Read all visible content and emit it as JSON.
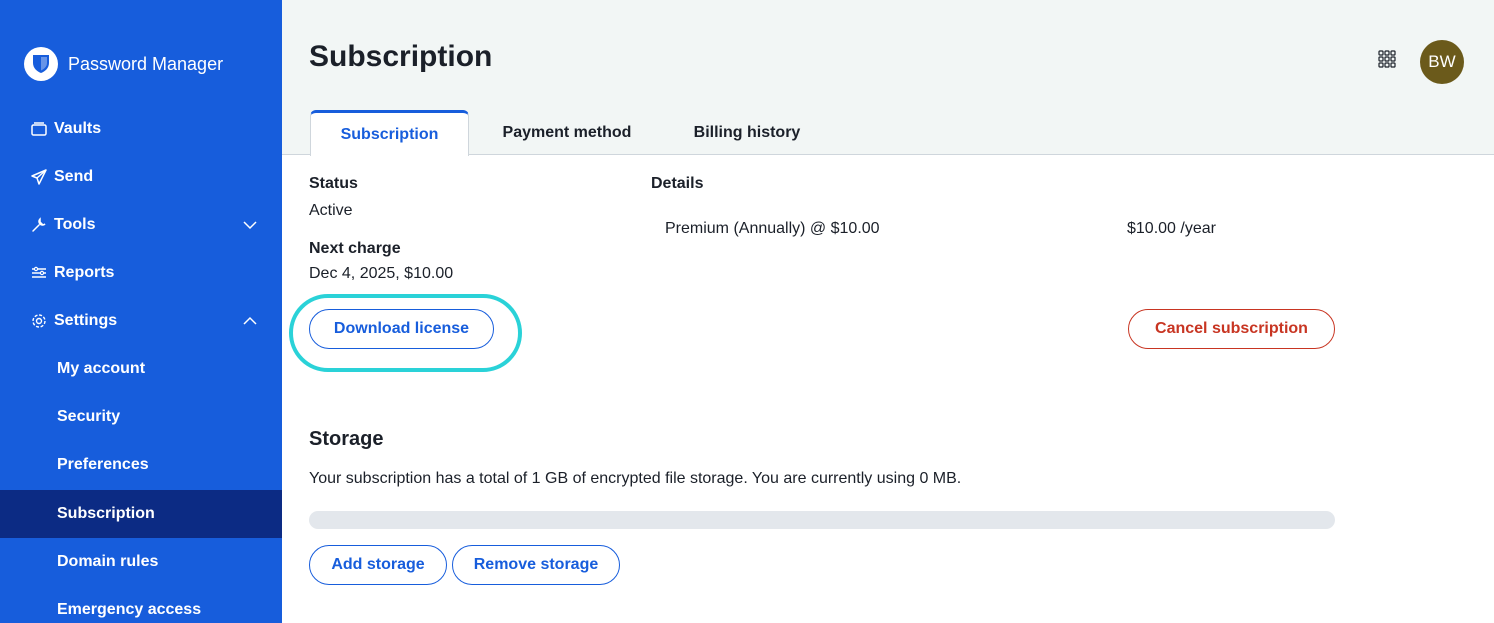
{
  "sidebar": {
    "brand": "Password Manager",
    "nav": [
      {
        "label": "Vaults",
        "icon": "vault-icon"
      },
      {
        "label": "Send",
        "icon": "send-icon"
      },
      {
        "label": "Tools",
        "icon": "tools-icon",
        "chevron": "down"
      },
      {
        "label": "Reports",
        "icon": "reports-icon"
      },
      {
        "label": "Settings",
        "icon": "settings-icon",
        "chevron": "up"
      }
    ],
    "settings_items": [
      {
        "label": "My account"
      },
      {
        "label": "Security"
      },
      {
        "label": "Preferences"
      },
      {
        "label": "Subscription",
        "active": true
      },
      {
        "label": "Domain rules"
      },
      {
        "label": "Emergency access"
      }
    ]
  },
  "header": {
    "title": "Subscription",
    "avatar_initials": "BW",
    "avatar_color": "#6b5a1b",
    "tabs": [
      {
        "label": "Subscription",
        "active": true
      },
      {
        "label": "Payment method"
      },
      {
        "label": "Billing history"
      }
    ]
  },
  "subscription": {
    "status_label": "Status",
    "status_value": "Active",
    "next_charge_label": "Next charge",
    "next_charge_value": "Dec 4, 2025, $10.00",
    "details_label": "Details",
    "plan_line": "Premium (Annually) @ $10.00",
    "plan_price": "$10.00 /year",
    "download_license_button": "Download license",
    "cancel_subscription_button": "Cancel subscription"
  },
  "storage": {
    "title": "Storage",
    "description": "Your subscription has a total of 1 GB of encrypted file storage. You are currently using 0 MB.",
    "used_fraction": 0,
    "add_button": "Add storage",
    "remove_button": "Remove storage"
  },
  "colors": {
    "sidebar": "#175ddc",
    "sidebar_active": "#0c2b84",
    "primary": "#175ddc",
    "danger": "#c83522",
    "highlight": "#2ad2d8"
  }
}
